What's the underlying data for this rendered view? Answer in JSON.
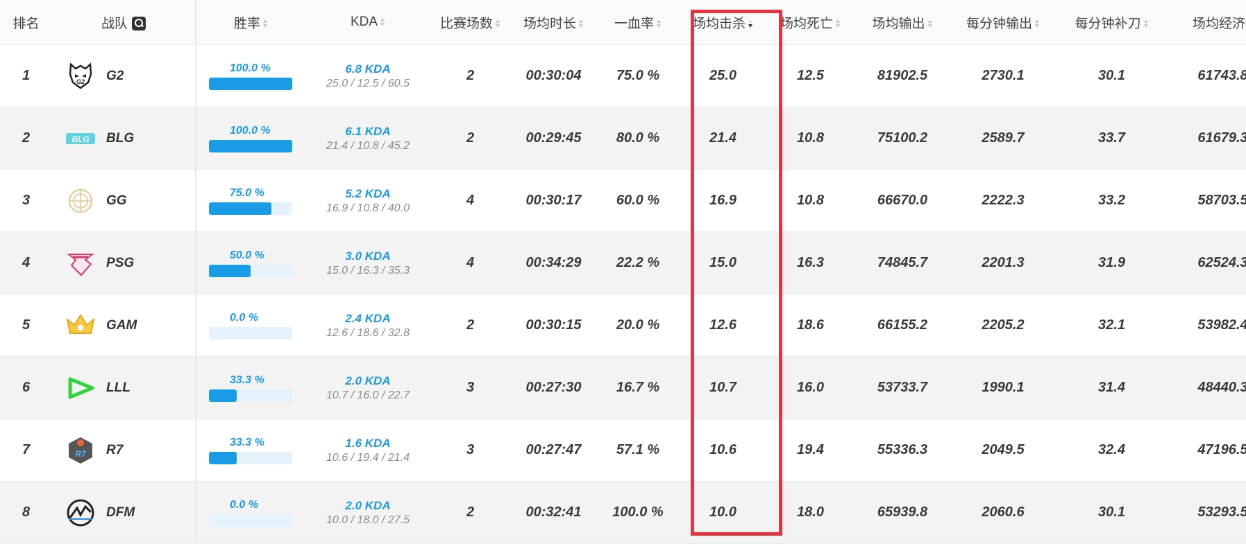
{
  "headers": {
    "rank": "排名",
    "team": "战队",
    "win_rate": "胜率",
    "kda": "KDA",
    "matches": "比赛场数",
    "duration": "场均时长",
    "first_blood": "一血率",
    "kills": "场均击杀",
    "deaths": "场均死亡",
    "damage": "场均输出",
    "dpm": "每分钟输出",
    "cspm": "每分钟补刀",
    "gold": "场均经济"
  },
  "sorted_column": "kills",
  "highlight_color": "#e8333f",
  "accent_color": "#1a9be6",
  "rows": [
    {
      "rank": "1",
      "team": "G2",
      "logo": "g2-logo-icon",
      "win_rate": "100.0 %",
      "win_rate_value": 100.0,
      "kda": "6.8 KDA",
      "kda_detail": "25.0 / 12.5 / 60.5",
      "matches": "2",
      "duration": "00:30:04",
      "first_blood": "75.0 %",
      "kills": "25.0",
      "deaths": "12.5",
      "damage": "81902.5",
      "dpm": "2730.1",
      "cspm": "30.1",
      "gold": "61743.8"
    },
    {
      "rank": "2",
      "team": "BLG",
      "logo": "blg-logo-icon",
      "win_rate": "100.0 %",
      "win_rate_value": 100.0,
      "kda": "6.1 KDA",
      "kda_detail": "21.4 / 10.8 / 45.2",
      "matches": "2",
      "duration": "00:29:45",
      "first_blood": "80.0 %",
      "kills": "21.4",
      "deaths": "10.8",
      "damage": "75100.2",
      "dpm": "2589.7",
      "cspm": "33.7",
      "gold": "61679.3"
    },
    {
      "rank": "3",
      "team": "GG",
      "logo": "gg-logo-icon",
      "win_rate": "75.0 %",
      "win_rate_value": 75.0,
      "kda": "5.2 KDA",
      "kda_detail": "16.9 / 10.8 / 40.0",
      "matches": "4",
      "duration": "00:30:17",
      "first_blood": "60.0 %",
      "kills": "16.9",
      "deaths": "10.8",
      "damage": "66670.0",
      "dpm": "2222.3",
      "cspm": "33.2",
      "gold": "58703.5"
    },
    {
      "rank": "4",
      "team": "PSG",
      "logo": "psg-logo-icon",
      "win_rate": "50.0 %",
      "win_rate_value": 50.0,
      "kda": "3.0 KDA",
      "kda_detail": "15.0 / 16.3 / 35.3",
      "matches": "4",
      "duration": "00:34:29",
      "first_blood": "22.2 %",
      "kills": "15.0",
      "deaths": "16.3",
      "damage": "74845.7",
      "dpm": "2201.3",
      "cspm": "31.9",
      "gold": "62524.3"
    },
    {
      "rank": "5",
      "team": "GAM",
      "logo": "gam-logo-icon",
      "win_rate": "0.0 %",
      "win_rate_value": 0.0,
      "kda": "2.4 KDA",
      "kda_detail": "12.6 / 18.6 / 32.8",
      "matches": "2",
      "duration": "00:30:15",
      "first_blood": "20.0 %",
      "kills": "12.6",
      "deaths": "18.6",
      "damage": "66155.2",
      "dpm": "2205.2",
      "cspm": "32.1",
      "gold": "53982.4"
    },
    {
      "rank": "6",
      "team": "LLL",
      "logo": "lll-logo-icon",
      "win_rate": "33.3 %",
      "win_rate_value": 33.3,
      "kda": "2.0 KDA",
      "kda_detail": "10.7 / 16.0 / 22.7",
      "matches": "3",
      "duration": "00:27:30",
      "first_blood": "16.7 %",
      "kills": "10.7",
      "deaths": "16.0",
      "damage": "53733.7",
      "dpm": "1990.1",
      "cspm": "31.4",
      "gold": "48440.3"
    },
    {
      "rank": "7",
      "team": "R7",
      "logo": "r7-logo-icon",
      "win_rate": "33.3 %",
      "win_rate_value": 33.3,
      "kda": "1.6 KDA",
      "kda_detail": "10.6 / 19.4 / 21.4",
      "matches": "3",
      "duration": "00:27:47",
      "first_blood": "57.1 %",
      "kills": "10.6",
      "deaths": "19.4",
      "damage": "55336.3",
      "dpm": "2049.5",
      "cspm": "32.4",
      "gold": "47196.5"
    },
    {
      "rank": "8",
      "team": "DFM",
      "logo": "dfm-logo-icon",
      "win_rate": "0.0 %",
      "win_rate_value": 0.0,
      "kda": "2.0 KDA",
      "kda_detail": "10.0 / 18.0 / 27.5",
      "matches": "2",
      "duration": "00:32:41",
      "first_blood": "100.0 %",
      "kills": "10.0",
      "deaths": "18.0",
      "damage": "65939.8",
      "dpm": "2060.6",
      "cspm": "30.1",
      "gold": "53293.5"
    }
  ]
}
